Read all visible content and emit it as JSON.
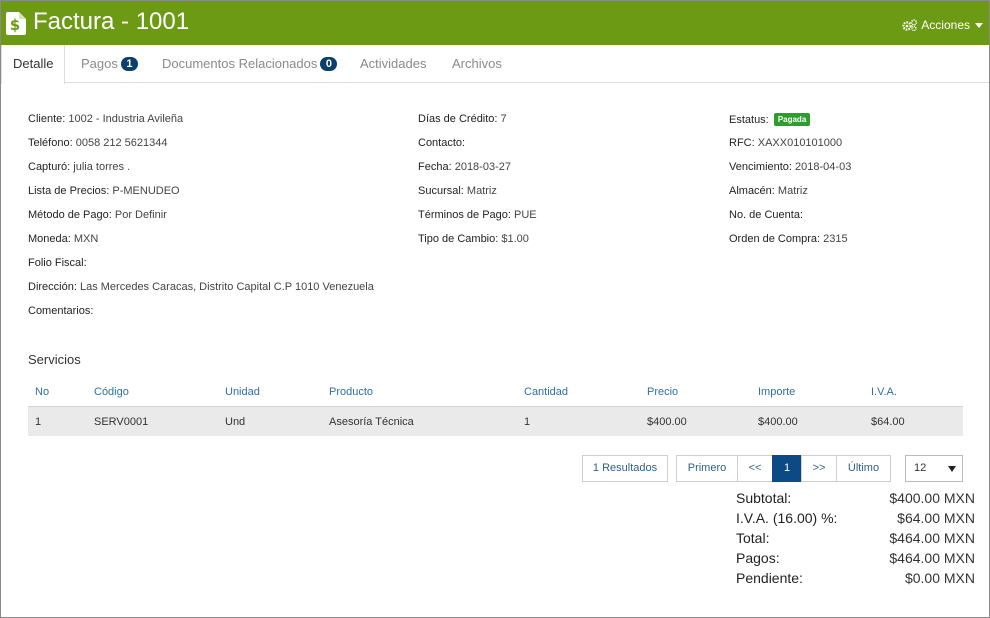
{
  "header": {
    "title": "Factura - 1001",
    "actions_label": "Acciones",
    "bg_color": "#6c9a14"
  },
  "tabs": [
    {
      "label": "Detalle",
      "active": true
    },
    {
      "label": "Pagos",
      "badge": "1"
    },
    {
      "label": "Documentos Relacionados",
      "badge": "0"
    },
    {
      "label": "Actividades"
    },
    {
      "label": "Archivos"
    }
  ],
  "details": {
    "cliente": {
      "label": "Cliente:",
      "value": "1002 - Industria Avileña"
    },
    "telefono": {
      "label": "Teléfono:",
      "value": "0058 212 5621344"
    },
    "capturo": {
      "label": "Capturó:",
      "value": "julia torres ."
    },
    "lista_precios": {
      "label": "Lista de Precios:",
      "value": "P-MENUDEO"
    },
    "metodo_pago": {
      "label": "Método de Pago:",
      "value": "Por Definir"
    },
    "moneda": {
      "label": "Moneda:",
      "value": "MXN"
    },
    "folio_fiscal": {
      "label": "Folio Fiscal:",
      "value": ""
    },
    "direccion": {
      "label": "Dirección:",
      "value": "Las Mercedes Caracas, Distrito Capital C.P 1010 Venezuela"
    },
    "comentarios": {
      "label": "Comentarios:",
      "value": ""
    },
    "dias_credito": {
      "label": "Días de Crédito:",
      "value": "7"
    },
    "contacto": {
      "label": "Contacto:",
      "value": ""
    },
    "fecha": {
      "label": "Fecha:",
      "value": "2018-03-27"
    },
    "sucursal": {
      "label": "Sucursal:",
      "value": "Matriz"
    },
    "terminos_pago": {
      "label": "Términos de Pago:",
      "value": "PUE"
    },
    "tipo_cambio": {
      "label": "Tipo de Cambio:",
      "value": "$1.00"
    },
    "estatus": {
      "label": "Estatus:",
      "value": "Pagada",
      "color": "#2e9c2e"
    },
    "rfc": {
      "label": "RFC:",
      "value": "XAXX010101000"
    },
    "vencimiento": {
      "label": "Vencimiento:",
      "value": "2018-04-03"
    },
    "almacen": {
      "label": "Almacén:",
      "value": "Matriz"
    },
    "no_cuenta": {
      "label": "No. de Cuenta:",
      "value": ""
    },
    "orden_compra": {
      "label": "Orden de Compra:",
      "value": "2315"
    }
  },
  "services": {
    "title": "Servicios",
    "columns": [
      "No",
      "Código",
      "Unidad",
      "Producto",
      "Cantidad",
      "Precio",
      "Importe",
      "I.V.A."
    ],
    "rows": [
      [
        "1",
        "SERV0001",
        "Und",
        "Asesoría Técnica",
        "1",
        "$400.00",
        "$400.00",
        "$64.00"
      ]
    ]
  },
  "pager": {
    "results": "1 Resultados",
    "first": "Primero",
    "prev": "<<",
    "current": "1",
    "next": ">>",
    "last": "Último",
    "page_size": "12"
  },
  "totals": [
    {
      "label": "Subtotal:",
      "value": "$400.00 MXN"
    },
    {
      "label": "I.V.A. (16.00) %:",
      "value": "$64.00 MXN"
    },
    {
      "label": "Total:",
      "value": "$464.00 MXN"
    },
    {
      "label": "Pagos:",
      "value": "$464.00 MXN"
    },
    {
      "label": "Pendiente:",
      "value": "$0.00 MXN"
    }
  ]
}
